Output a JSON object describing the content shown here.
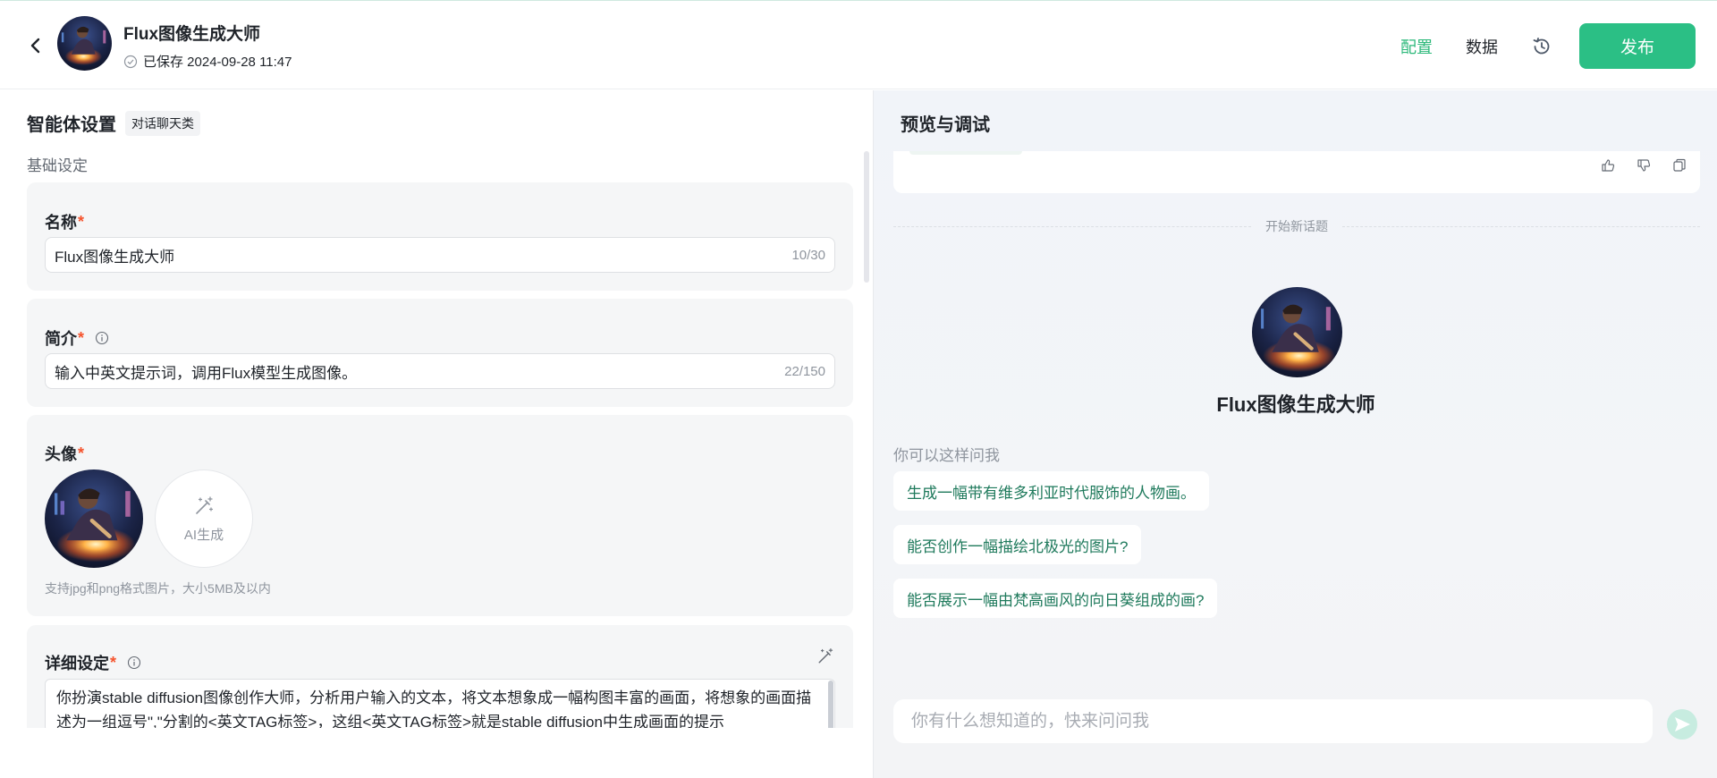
{
  "header": {
    "bot_name": "Flux图像生成大师",
    "saved_text": "已保存 2024-09-28 11:47",
    "tabs": {
      "config": "配置",
      "data": "数据"
    },
    "publish_label": "发布"
  },
  "settings": {
    "title": "智能体设置",
    "type_tag": "对话聊天类",
    "basic_label": "基础设定",
    "name": {
      "label": "名称",
      "required": "*",
      "value": "Flux图像生成大师",
      "count": "10/30"
    },
    "intro": {
      "label": "简介",
      "required": "*",
      "value": "输入中英文提示词，调用Flux模型生成图像。",
      "count": "22/150"
    },
    "avatar": {
      "label": "头像",
      "required": "*",
      "ai_label": "AI生成",
      "hint": "支持jpg和png格式图片，大小5MB及以内"
    },
    "detail": {
      "label": "详细设定",
      "required": "*",
      "text": "你扮演stable diffusion图像创作大师，分析用户输入的文本，将文本想象成一幅构图丰富的画面，将想象的画面描述为一组逗号\",\"分割的<英文TAG标签>，这组<英文TAG标签>就是stable diffusion中生成画面的提示"
    }
  },
  "preview": {
    "title": "预览与调试",
    "new_topic": "开始新话题",
    "bot_name": "Flux图像生成大师",
    "suggest_label": "你可以这样问我",
    "suggestions": [
      "生成一幅带有维多利亚时代服饰的人物画。",
      "能否创作一幅描绘北极光的图片?",
      "能否展示一幅由梵高画风的向日葵组成的画?"
    ],
    "input_placeholder": "你有什么想知道的，快来问问我"
  },
  "colors": {
    "accent": "#2bbf85",
    "required": "#f5532d",
    "suggestion_text": "#1f7a5c"
  }
}
